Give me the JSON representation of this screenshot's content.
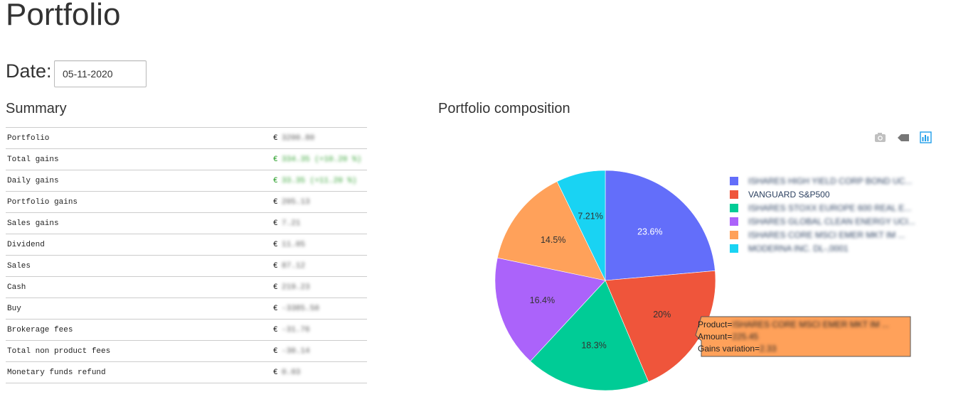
{
  "page": {
    "title": "Portfolio"
  },
  "date": {
    "label": "Date:",
    "value": "05-11-2020"
  },
  "summary": {
    "heading": "Summary",
    "currency": "€",
    "rows": [
      {
        "label": "Portfolio",
        "value": "3200.80",
        "tone": "neutral"
      },
      {
        "label": "Total gains",
        "value": "334.35 (+10.20 %)",
        "tone": "positive"
      },
      {
        "label": "Daily gains",
        "value": "33.35 (+11.20 %)",
        "tone": "positive"
      },
      {
        "label": "Portfolio gains",
        "value": "205.13",
        "tone": "neutral"
      },
      {
        "label": "Sales gains",
        "value": "7.21",
        "tone": "neutral"
      },
      {
        "label": "Dividend",
        "value": "11.05",
        "tone": "neutral"
      },
      {
        "label": "Sales",
        "value": "87.12",
        "tone": "neutral"
      },
      {
        "label": "Cash",
        "value": "219.23",
        "tone": "neutral"
      },
      {
        "label": "Buy",
        "value": "-3385.50",
        "tone": "neutral"
      },
      {
        "label": "Brokerage fees",
        "value": "-31.76",
        "tone": "neutral"
      },
      {
        "label": "Total non product fees",
        "value": "-30.14",
        "tone": "neutral"
      },
      {
        "label": "Monetary funds refund",
        "value": "0.03",
        "tone": "neutral"
      }
    ]
  },
  "composition": {
    "heading": "Portfolio composition",
    "modebar": [
      "camera-icon",
      "tag-icon",
      "bar-chart-icon"
    ],
    "hover": {
      "product_label": "Product=",
      "product_value": "ISHARES CORE MSCI EMER MKT IM ...",
      "amount_label": "Amount=",
      "amount_value": "225.45",
      "gains_label": "Gains variation=",
      "gains_value": "2.33"
    }
  },
  "chart_data": {
    "type": "pie",
    "title": "Portfolio composition",
    "labels": [
      "ISHARES HIGH YIELD CORP BOND UC...",
      "VANGUARD S&P500",
      "ISHARES STOXX EUROPE 600 REAL E...",
      "ISHARES GLOBAL CLEAN ENERGY UCI...",
      "ISHARES CORE MSCI EMER MKT IM ...",
      "MODERNA INC. DL-,0001"
    ],
    "blurred_labels": [
      true,
      false,
      true,
      true,
      true,
      true
    ],
    "values": [
      23.6,
      20.0,
      18.3,
      16.4,
      14.5,
      7.21
    ],
    "display_labels": [
      "23.6%",
      "20%",
      "18.3%",
      "16.4%",
      "14.5%",
      "7.21%"
    ],
    "colors": [
      "#636efa",
      "#EF553B",
      "#00cc96",
      "#ab63fa",
      "#FFA15A",
      "#19d3f3"
    ],
    "text_colors": [
      "#ffffff",
      "#333333",
      "#333333",
      "#333333",
      "#333333",
      "#333333"
    ],
    "highlighted_slice": 4,
    "legend_position": "right"
  }
}
